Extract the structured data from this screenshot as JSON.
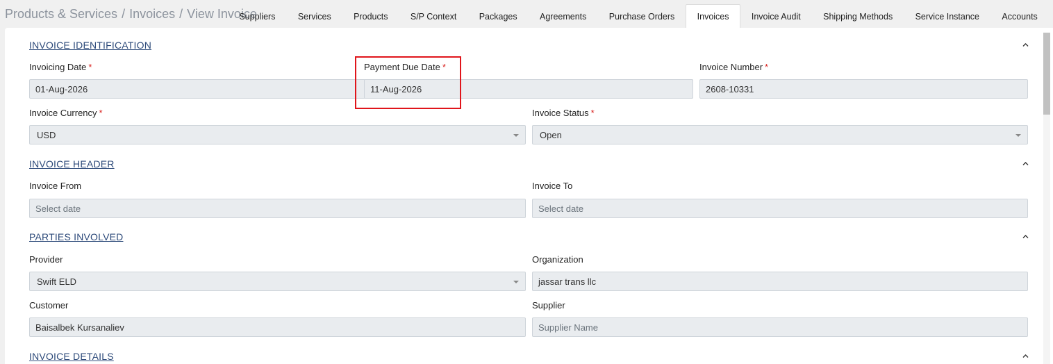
{
  "breadcrumb": {
    "items": [
      "Products & Services",
      "Invoices",
      "View Invoice"
    ],
    "separator": "/"
  },
  "tabs": [
    {
      "label": "Suppliers",
      "active": false
    },
    {
      "label": "Services",
      "active": false
    },
    {
      "label": "Products",
      "active": false
    },
    {
      "label": "S/P Context",
      "active": false
    },
    {
      "label": "Packages",
      "active": false
    },
    {
      "label": "Agreements",
      "active": false
    },
    {
      "label": "Purchase Orders",
      "active": false
    },
    {
      "label": "Invoices",
      "active": true
    },
    {
      "label": "Invoice Audit",
      "active": false
    },
    {
      "label": "Shipping Methods",
      "active": false
    },
    {
      "label": "Service Instance",
      "active": false
    },
    {
      "label": "Accounts",
      "active": false
    }
  ],
  "required_marker": "*",
  "sections": {
    "identification": {
      "title": "INVOICE IDENTIFICATION",
      "invoicing_date": {
        "label": "Invoicing Date",
        "value": "01-Aug-2026"
      },
      "payment_due_date": {
        "label": "Payment Due Date",
        "value": "11-Aug-2026"
      },
      "invoice_number": {
        "label": "Invoice Number",
        "value": "2608-10331"
      },
      "currency": {
        "label": "Invoice Currency",
        "value": "USD"
      },
      "status": {
        "label": "Invoice Status",
        "value": "Open"
      }
    },
    "header": {
      "title": "INVOICE HEADER",
      "invoice_from": {
        "label": "Invoice From",
        "placeholder": "Select date"
      },
      "invoice_to": {
        "label": "Invoice To",
        "placeholder": "Select date"
      }
    },
    "parties": {
      "title": "PARTIES INVOLVED",
      "provider": {
        "label": "Provider",
        "value": "Swift ELD"
      },
      "organization": {
        "label": "Organization",
        "value": "jassar trans llc"
      },
      "customer": {
        "label": "Customer",
        "value": "Baisalbek Kursanaliev"
      },
      "supplier": {
        "label": "Supplier",
        "placeholder": "Supplier Name"
      }
    },
    "details": {
      "title": "INVOICE DETAILS"
    }
  },
  "colors": {
    "section_title": "#2d4a7a",
    "required": "#d9231f",
    "highlight": "#e0151b",
    "field_bg": "#e9ecef"
  }
}
